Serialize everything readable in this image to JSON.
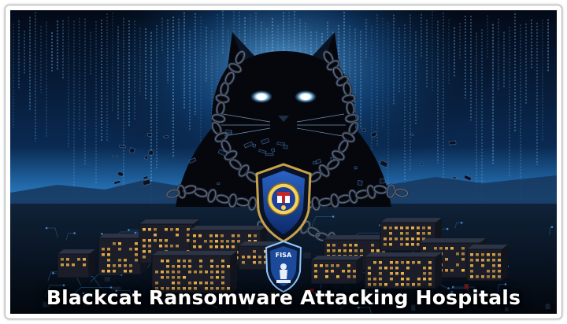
{
  "caption": "Blackcat Ransomware Attacking Hospitals",
  "badge_top_label": "",
  "badge_bottom_label": "FISA",
  "colors": {
    "sky_top": "#041022",
    "glow": "#3aa8ff",
    "code": "#7fc8ff",
    "building": "#1b1e28",
    "window": "#f2b24a",
    "badge": "#1a3f8f",
    "caption": "#ffffff"
  },
  "icons": [
    "cat-silhouette",
    "chain",
    "shield-badge",
    "seal-icon",
    "keyhole-figure-icon"
  ]
}
